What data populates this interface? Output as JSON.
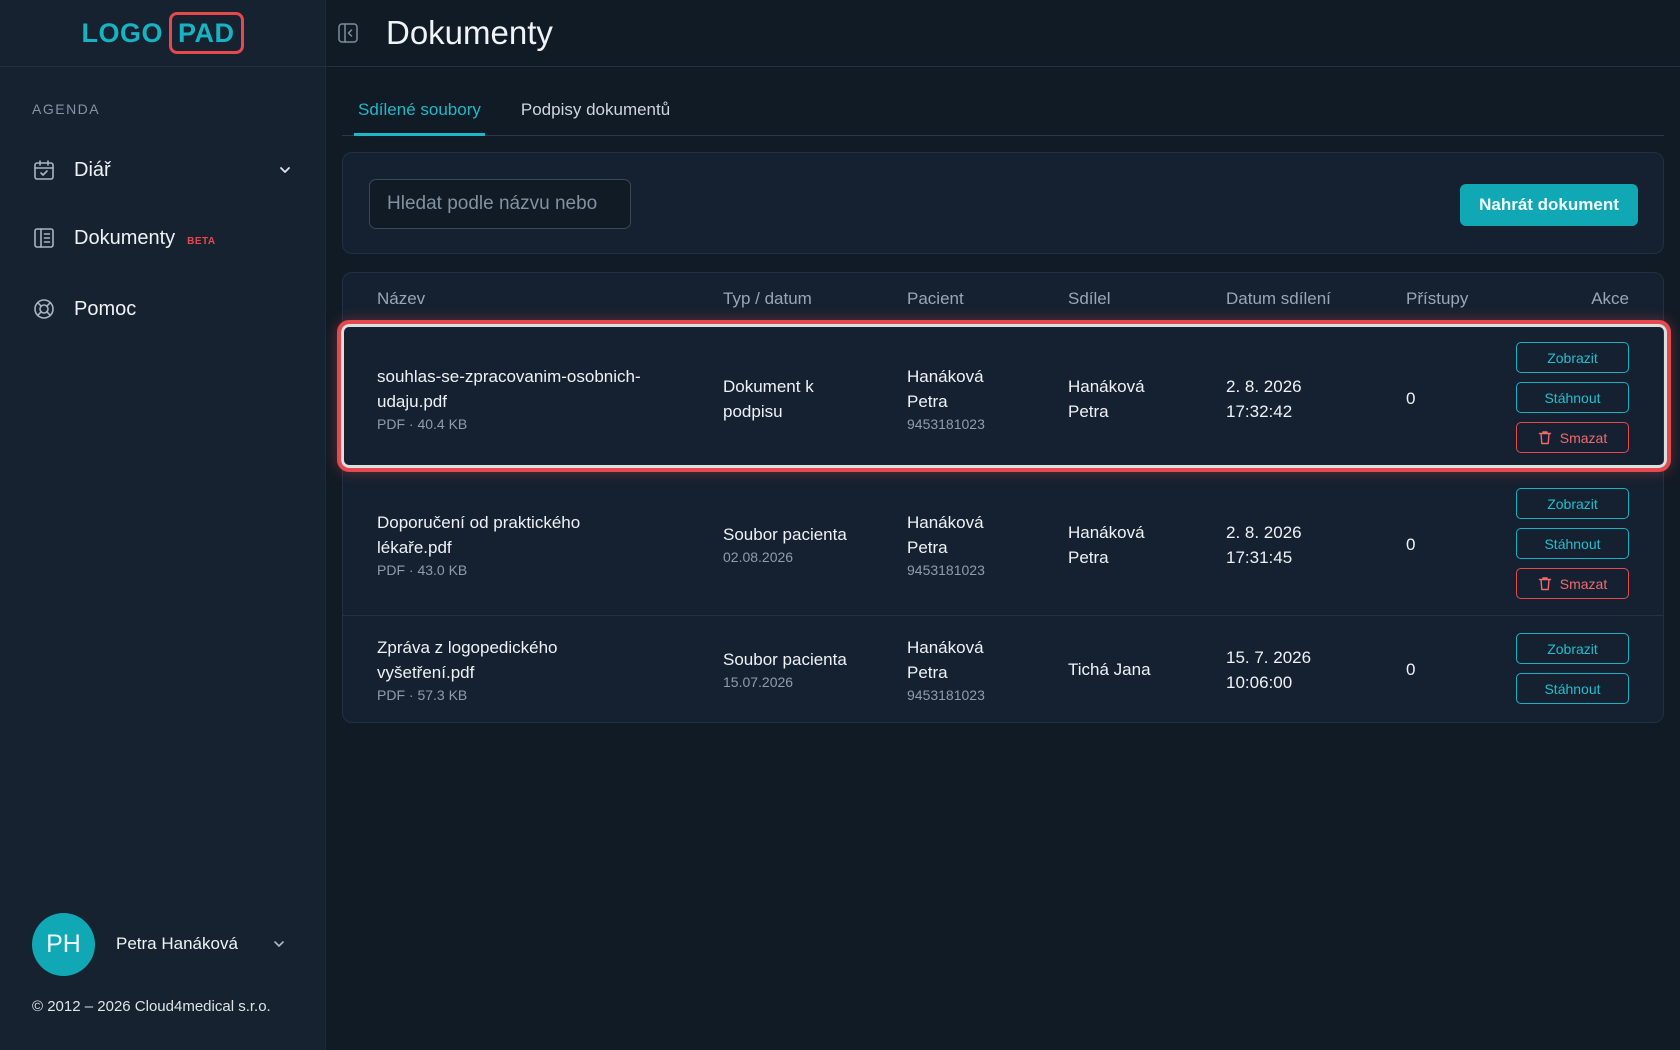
{
  "sidebar": {
    "logo_left": "LOGO",
    "logo_right": "PAD",
    "section_label": "AGENDA",
    "items": [
      {
        "label": "Diář",
        "icon": "calendar-check-icon"
      },
      {
        "label": "Dokumenty",
        "icon": "document-icon",
        "badge": "BETA"
      },
      {
        "label": "Pomoc",
        "icon": "lifebuoy-icon"
      }
    ],
    "user": {
      "initials": "PH",
      "name": "Petra Hanáková"
    },
    "footer": "© 2012 – 2026 Cloud4medical s.r.o."
  },
  "header": {
    "title": "Dokumenty"
  },
  "tabs": [
    {
      "label": "Sdílené soubory",
      "active": true
    },
    {
      "label": "Podpisy dokumentů",
      "active": false
    }
  ],
  "toolbar": {
    "search_placeholder": "Hledat podle názvu nebo",
    "upload_label": "Nahrát dokument"
  },
  "table": {
    "headers": [
      "Název",
      "Typ / datum",
      "Pacient",
      "Sdílel",
      "Datum sdílení",
      "Přístupy",
      "Akce"
    ],
    "rows": [
      {
        "name_line1": "souhlas-se-zpracovanim-osobnich-",
        "name_line2": "udaju.pdf",
        "meta": "PDF · 40.4 KB",
        "type_line1": "Dokument k",
        "type_line2": "podpisu",
        "type_date": "",
        "patient_line1": "Hanáková",
        "patient_line2": "Petra",
        "patient_id": "9453181023",
        "shared_line1": "Hanáková",
        "shared_line2": "Petra",
        "date_line1": "2. 8. 2026",
        "date_line2": "17:32:42",
        "access": "0",
        "highlighted": true
      },
      {
        "name_line1": "Doporučení od praktického",
        "name_line2": "lékaře.pdf",
        "meta": "PDF · 43.0 KB",
        "type_line1": "Soubor pacienta",
        "type_line2": "",
        "type_date": "02.08.2026",
        "patient_line1": "Hanáková",
        "patient_line2": "Petra",
        "patient_id": "9453181023",
        "shared_line1": "Hanáková",
        "shared_line2": "Petra",
        "date_line1": "2. 8. 2026",
        "date_line2": "17:31:45",
        "access": "0"
      },
      {
        "name_line1": "Zpráva z logopedického",
        "name_line2": "vyšetření.pdf",
        "meta": "PDF · 57.3 KB",
        "type_line1": "Soubor pacienta",
        "type_line2": "",
        "type_date": "15.07.2026",
        "patient_line1": "Hanáková",
        "patient_line2": "Petra",
        "patient_id": "9453181023",
        "shared_line1": "Tichá Jana",
        "shared_line2": "",
        "date_line1": "15. 7. 2026",
        "date_line2": "10:06:00",
        "access": "0"
      }
    ],
    "actions": {
      "view": "Zobrazit",
      "download": "Stáhnout",
      "delete": "Smazat"
    }
  },
  "colors": {
    "accent": "#11a8b6",
    "danger": "#e5484d",
    "background": "#111b26",
    "sidebar": "#172230"
  }
}
